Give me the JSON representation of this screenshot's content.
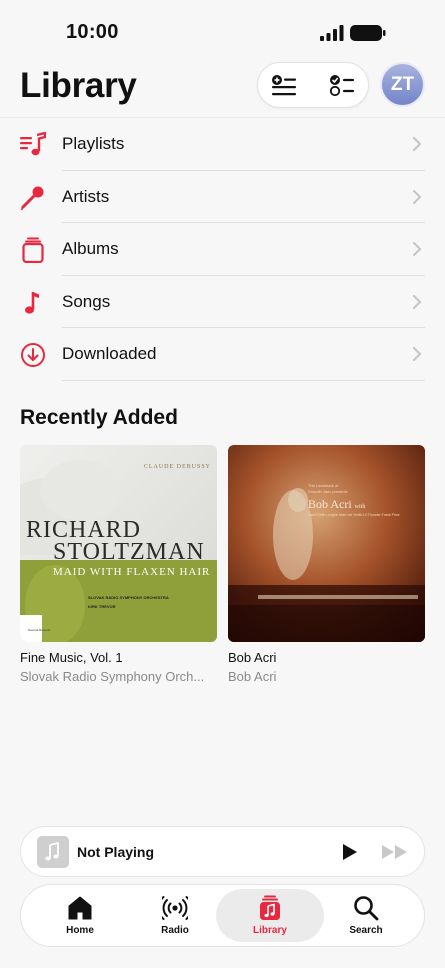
{
  "status_bar": {
    "time": "10:00"
  },
  "header": {
    "title": "Library",
    "avatar_initials": "ZT",
    "actions": [
      {
        "icon": "add-to-list-icon"
      },
      {
        "icon": "select-list-icon"
      }
    ]
  },
  "library_items": [
    {
      "label": "Playlists",
      "icon": "playlists-icon"
    },
    {
      "label": "Artists",
      "icon": "microphone-icon"
    },
    {
      "label": "Albums",
      "icon": "albums-icon"
    },
    {
      "label": "Songs",
      "icon": "music-note-icon"
    },
    {
      "label": "Downloaded",
      "icon": "download-circle-icon"
    }
  ],
  "recently_added": {
    "title": "Recently Added",
    "albums": [
      {
        "title": "Fine Music, Vol. 1",
        "artist": "Slovak Radio Symphony Orch...",
        "cover": {
          "composer": "CLAUDE DEBUSSY",
          "line1": "RICHARD",
          "line2": "STOLTZMAN",
          "subtitle": "MAID WITH FLAXEN HAIR",
          "credit1": "SLOVAK RADIO SYMPHONY ORCHESTRA",
          "credit2": "KIRK TREVOR",
          "label": "Navona Records"
        }
      },
      {
        "title": "Bob Acri",
        "artist": "Bob Acri",
        "cover": {
          "top_line1": "The Landmark of",
          "top_line2": "Smooth Jazz presents",
          "name": "Bob Acri",
          "name_suffix": "with",
          "credits": "Carlo Delle Lunghe   Max Lee Smith   Lil Thunder   Frank Price"
        }
      }
    ]
  },
  "now_playing": {
    "label": "Not Playing"
  },
  "tab_bar": {
    "tabs": [
      {
        "label": "Home",
        "icon": "home-icon"
      },
      {
        "label": "Radio",
        "icon": "radio-icon"
      },
      {
        "label": "Library",
        "icon": "library-icon",
        "active": true
      },
      {
        "label": "Search",
        "icon": "search-icon"
      }
    ]
  },
  "colors": {
    "accent": "#e8283f",
    "background": "#f7f7f7"
  }
}
